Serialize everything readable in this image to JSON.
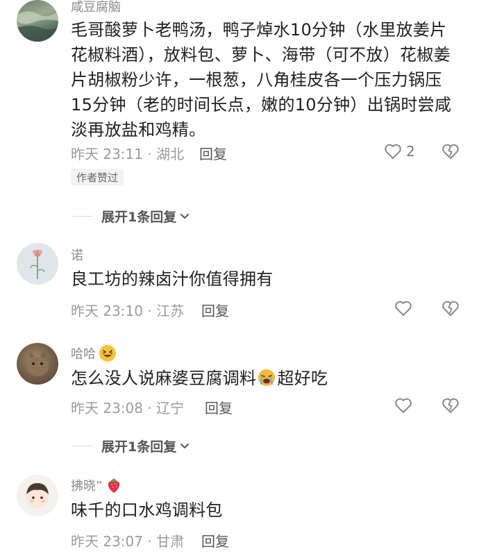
{
  "comments": [
    {
      "username": "咸豆腐脑",
      "text": "毛哥酸萝卜老鸭汤，鸭子焯水10分钟（水里放姜片花椒料酒），放料包、萝卜、海带（可不放）花椒姜片胡椒粉少许，一根葱，八角桂皮各一个压力锅压15分钟（老的时间长点，嫩的10分钟）出锅时尝咸淡再放盐和鸡精。",
      "meta": "昨天 23:11 · 湖北",
      "reply_label": "回复",
      "like_count": "2",
      "author_liked": "作者赞过",
      "expand_label": "展开1条回复"
    },
    {
      "username": "诺",
      "text": "良工坊的辣卤汁你值得拥有",
      "meta": "昨天 23:10 · 江苏",
      "reply_label": "回复"
    },
    {
      "username": "哈哈",
      "text_before": "怎么没人说麻婆豆腐调料",
      "text_after": "超好吃",
      "meta": "昨天 23:08 · 辽宁",
      "reply_label": "回复",
      "expand_label": "展开1条回复"
    },
    {
      "username": "拂晓”",
      "text": "味千的口水鸡调料包",
      "meta": "昨天 23:07 · 甘肃",
      "reply_label": "回复"
    }
  ],
  "icons": {
    "like": "heart-outline-icon",
    "dislike": "broken-heart-icon",
    "expand": "chevron-down-icon"
  },
  "colors": {
    "meta_text": "#9a9a9a",
    "main_text": "#1f1f1f",
    "icon": "#8a8a8a"
  }
}
